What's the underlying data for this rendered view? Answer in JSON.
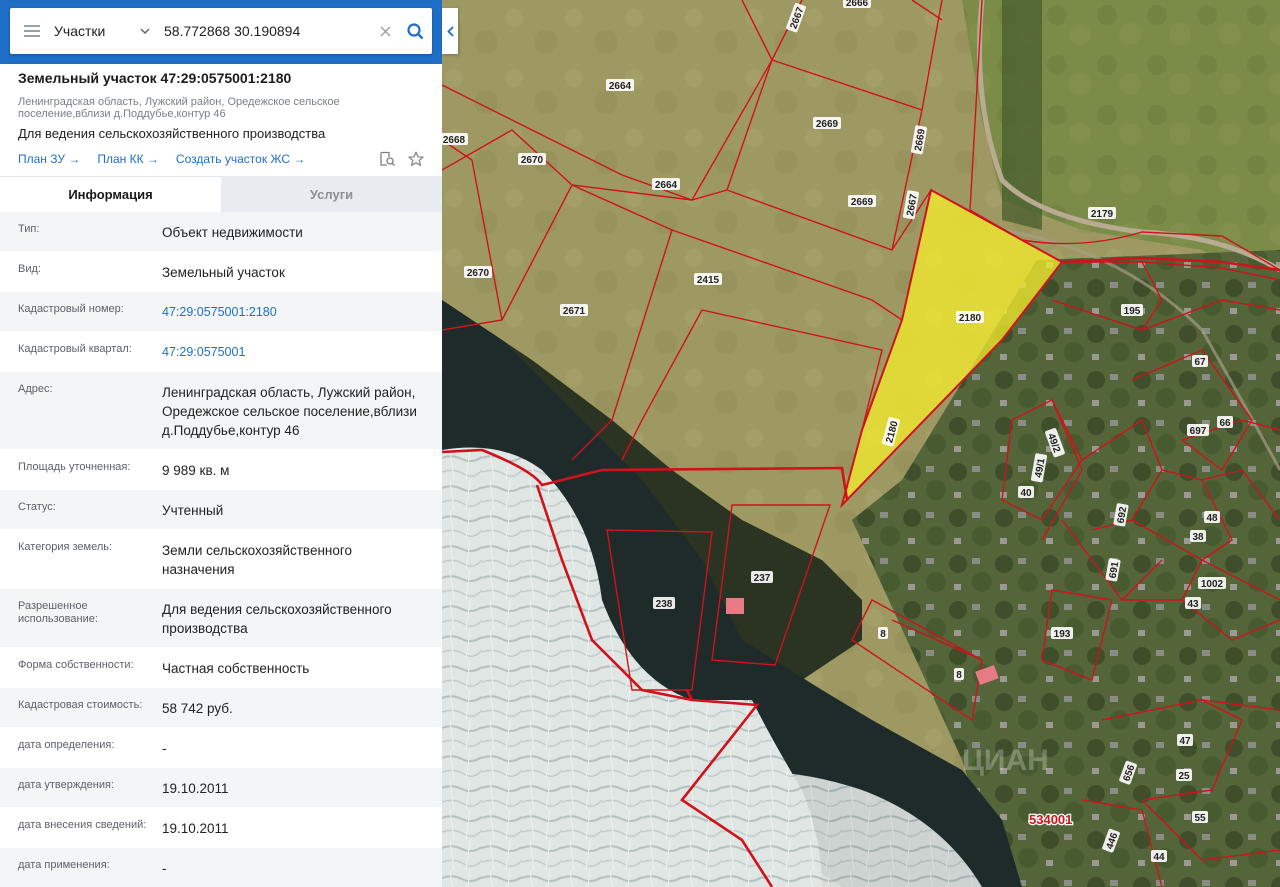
{
  "search": {
    "layer": "Участки",
    "query": "58.772868 30.190894"
  },
  "parcel": {
    "title": "Земельный участок 47:29:0575001:2180",
    "address_short": "Ленинградская область, Лужский район, Оредежское сельское поселение,вблизи д.Поддубье,контур 46",
    "purpose": "Для ведения сельскохозяйственного производства",
    "links": [
      "План ЗУ →",
      "План КК →",
      "Создать участок ЖС →"
    ]
  },
  "tabs": [
    "Информация",
    "Услуги"
  ],
  "info": [
    {
      "label": "Тип:",
      "value": "Объект недвижимости"
    },
    {
      "label": "Вид:",
      "value": "Земельный участок"
    },
    {
      "label": "Кадастровый номер:",
      "value": "47:29:0575001:2180"
    },
    {
      "label": "Кадастровый квартал:",
      "value": "47:29:0575001"
    },
    {
      "label": "Адрес:",
      "value": "Ленинградская область, Лужский район, Оредежское сельское поселение,вблизи д.Поддубье,контур 46"
    },
    {
      "label": "Площадь уточненная:",
      "value": "9 989 кв. м"
    },
    {
      "label": "Статус:",
      "value": "Учтенный"
    },
    {
      "label": "Категория земель:",
      "value": "Земли сельскохозяйственного назначения"
    },
    {
      "label": "Разрешенное использование:",
      "value": "Для ведения сельскохозяйственного производства"
    },
    {
      "label": "Форма собственности:",
      "value": "Частная собственность"
    },
    {
      "label": "Кадастровая стоимость:",
      "value": "58 742 руб."
    },
    {
      "label": "дата определения:",
      "value": "-"
    },
    {
      "label": "дата утверждения:",
      "value": "19.10.2011"
    },
    {
      "label": "дата внесения сведений:",
      "value": "19.10.2011"
    },
    {
      "label": "дата применения:",
      "value": "-"
    }
  ],
  "map": {
    "parcel_labels": [
      "2666",
      "2667",
      "2664",
      "2669",
      "2668",
      "2670",
      "2664",
      "2669",
      "2669",
      "2667",
      "2179",
      "2670",
      "2415",
      "2671",
      "2180",
      "195",
      "67",
      "697",
      "66",
      "49/1",
      "49/2",
      "40",
      "2180",
      "692",
      "48",
      "38",
      "691",
      "1002",
      "43",
      "237",
      "238",
      "8",
      "193",
      "8",
      "47",
      "656",
      "25",
      "55",
      "446",
      "44"
    ],
    "quarter_label": "534001"
  },
  "colors": {
    "accent": "#1e6ec8",
    "highlight_fill": "#f5ee2a",
    "boundary": "#d0121b"
  }
}
